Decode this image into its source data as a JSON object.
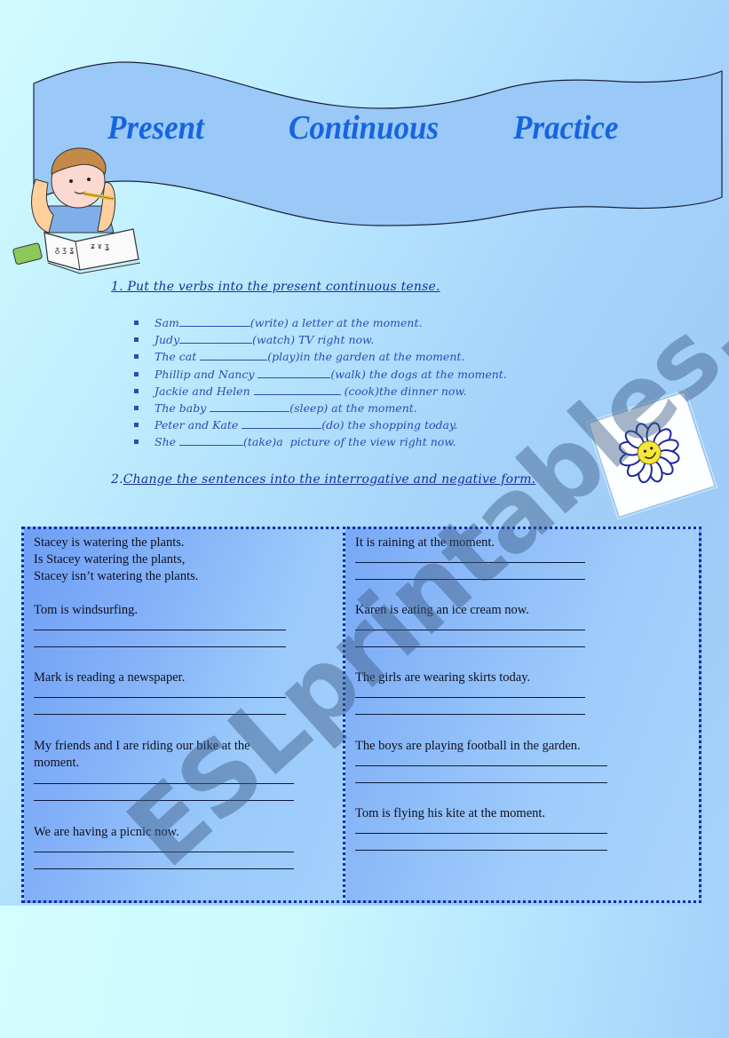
{
  "banner": {
    "title_words": [
      "Present",
      "Continuous",
      "Practice"
    ],
    "banner_color": "#9ac8f7",
    "title_color": "#1565e0"
  },
  "section1": {
    "heading": "1. Put the verbs into the present continuous tense.",
    "items": [
      {
        "subject": "Sam",
        "rest": "(write) a letter at the moment."
      },
      {
        "subject": "Judy",
        "rest": "(watch) TV right now."
      },
      {
        "subject": "The cat ",
        "rest": "(play)in the garden at the moment."
      },
      {
        "subject": "Phillip and Nancy ",
        "rest": "(walk) the dogs at the moment."
      },
      {
        "subject": "Jackie and Helen ",
        "rest": " (cook)the dinner now."
      },
      {
        "subject": "The baby ",
        "rest": "(sleep) at the moment."
      },
      {
        "subject": "Peter and Kate ",
        "rest": "(do) the shopping today."
      },
      {
        "subject": "She ",
        "rest": "(take)a  picture of the view right now."
      }
    ]
  },
  "section2": {
    "heading_number": "2.",
    "heading_text": "Change the sentences into the interrogative and negative form.",
    "example": {
      "statement": "Stacey is watering the plants.",
      "question": "Is Stacey watering the plants,",
      "negative": "Stacey isn’t watering the plants."
    },
    "left_sentences": [
      "Tom is windsurfing.",
      "Mark is reading a newspaper.",
      "My friends and I are riding our bike at the",
      "moment.",
      "We are having a picnic now."
    ],
    "right_sentences": [
      "It is raining at the moment.",
      "Karen is eating an ice cream now.",
      "The girls are wearing skirts today.",
      "The boys are playing football in the garden.",
      "Tom is flying his kite at the moment."
    ]
  },
  "watermark": "ESLprintables.com"
}
